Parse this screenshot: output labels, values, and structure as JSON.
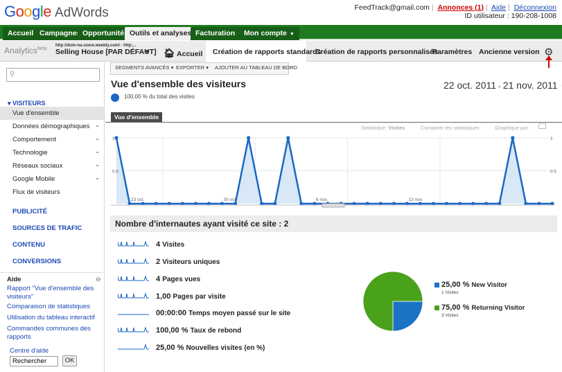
{
  "header": {
    "logo_text": "Google",
    "product": "AdWords",
    "email": "FeedTrack@gmail.com",
    "annonces": "Annonces (1)",
    "aide": "Aide",
    "deconnexion": "Déconnexion",
    "user_id": "ID utilisateur : 190-208-1008"
  },
  "green_nav": {
    "tabs": [
      "Accueil",
      "Campagnes",
      "Opportunités",
      "Outils et analyses",
      "Facturation",
      "Mon compte"
    ]
  },
  "analytics_bar": {
    "logo": "Analytics",
    "beta": "beta",
    "profile_url": "http://dom-na-ozere.weebly.com/ - http:...",
    "profile_name": "Selling House [PAR DÉFAUT]",
    "home": "Accueil",
    "tabs": [
      "Création de rapports standards",
      "Création de rapports personnalisés",
      "Paramètres",
      "Ancienne version"
    ]
  },
  "sidebar": {
    "search_placeholder": "",
    "visiteurs": "VISITEURS",
    "items": [
      "Vue d'ensemble",
      "Données démographiques",
      "Comportement",
      "Technologie",
      "Réseaux sociaux",
      "Google Mobile",
      "Flux de visiteurs"
    ],
    "sections": [
      "PUBLICITÉ",
      "SOURCES DE TRAFIC",
      "CONTENU",
      "CONVERSIONS"
    ],
    "aide_title": "Aide",
    "aide_links": [
      "Rapport \"Vue d'ensemble des visiteurs\"",
      "Comparaison de statistiques",
      "Utilisation du tableau interactif",
      "Commandes communes des rapports"
    ],
    "centre_aide": "Centre d'aide",
    "rechercher": "Rechercher",
    "ok": "OK"
  },
  "toolbar": {
    "segments": "SEGMENTS AVANCÉS",
    "exporter": "EXPORTER",
    "ajouter": "AJOUTER AU TABLEAU DE BORD"
  },
  "report": {
    "title": "Vue d'ensemble des visiteurs",
    "subtitle": "100,00 % du total des visites",
    "date_start": "22 oct. 2011",
    "date_sep": "-",
    "date_end": "21 nov. 2011",
    "view_tab": "Vue d'ensemble",
    "stat_label": "Statistique:",
    "stat_value": "Visites",
    "compare": "Comparer les statistiques",
    "graph_by": "Graphique par :",
    "summary_title": "Nombre d'internautes ayant visité ce site : 2"
  },
  "chart_data": {
    "type": "area",
    "x_labels": [
      "23 oct.",
      "30 oct.",
      "6 nov.",
      "13 nov."
    ],
    "y_ticks": [
      "1",
      "0.5"
    ],
    "ylim": [
      0,
      1
    ],
    "values": [
      1,
      0,
      0,
      0,
      0,
      0,
      0,
      0,
      0,
      0,
      1,
      0,
      0,
      1,
      0,
      0,
      0,
      0,
      0,
      0,
      0,
      0,
      0,
      0,
      0,
      0,
      0,
      0,
      0,
      0,
      1,
      0,
      0,
      0
    ],
    "accent_color": "#1a67c4"
  },
  "stats": [
    {
      "value": "4",
      "label": "Visites"
    },
    {
      "value": "2",
      "label": "Visiteurs uniques"
    },
    {
      "value": "4",
      "label": "Pages vues"
    },
    {
      "value": "1,00",
      "label": "Pages par visite"
    },
    {
      "value": "00:00:00",
      "label": "Temps moyen passé sur le site"
    },
    {
      "value": "100,00 %",
      "label": "Taux de rebond"
    },
    {
      "value": "25,00 %",
      "label": "Nouvelles visites (en %)"
    }
  ],
  "pie": {
    "slices": [
      {
        "pct": "25,00 %",
        "name": "New Visitor",
        "sub": "1 Visites",
        "value": 25,
        "color": "#1a73c4"
      },
      {
        "pct": "75,00 %",
        "name": "Returning Visitor",
        "sub": "3 Visites",
        "value": 75,
        "color": "#4aa11a"
      }
    ]
  }
}
